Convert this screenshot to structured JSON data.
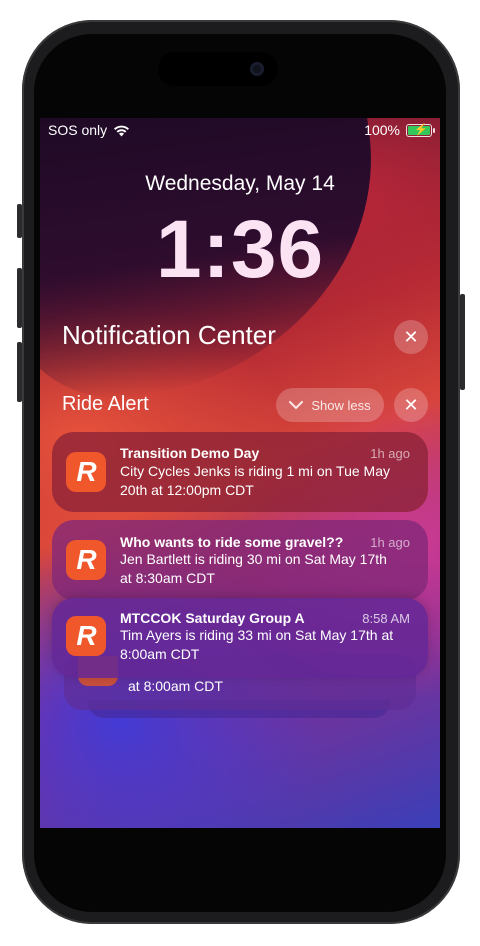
{
  "status_bar": {
    "carrier": "SOS only",
    "battery_percent": "100%"
  },
  "lock_screen": {
    "date": "Wednesday, May 14",
    "time": "1:36"
  },
  "notification_center": {
    "title": "Notification Center",
    "clear_icon": "x-icon"
  },
  "group": {
    "app_name": "Ride Alert",
    "show_less_label": "Show less",
    "app_icon_letter": "R",
    "notifications": [
      {
        "title": "Transition Demo Day",
        "time": "1h ago",
        "body": "City Cycles Jenks is riding 1 mi on Tue May 20th at 12:00pm CDT"
      },
      {
        "title": "Who wants to ride some gravel??",
        "time": "1h ago",
        "body": "Jen Bartlett is riding 30 mi on Sat May 17th at 8:30am CDT"
      },
      {
        "title": "MTCCOK Saturday Group A",
        "time": "8:58 AM",
        "body": "Tim Ayers is riding 33 mi on Sat May 17th at 8:00am CDT"
      }
    ],
    "stacked_partial_text": "at 8:00am CDT"
  }
}
